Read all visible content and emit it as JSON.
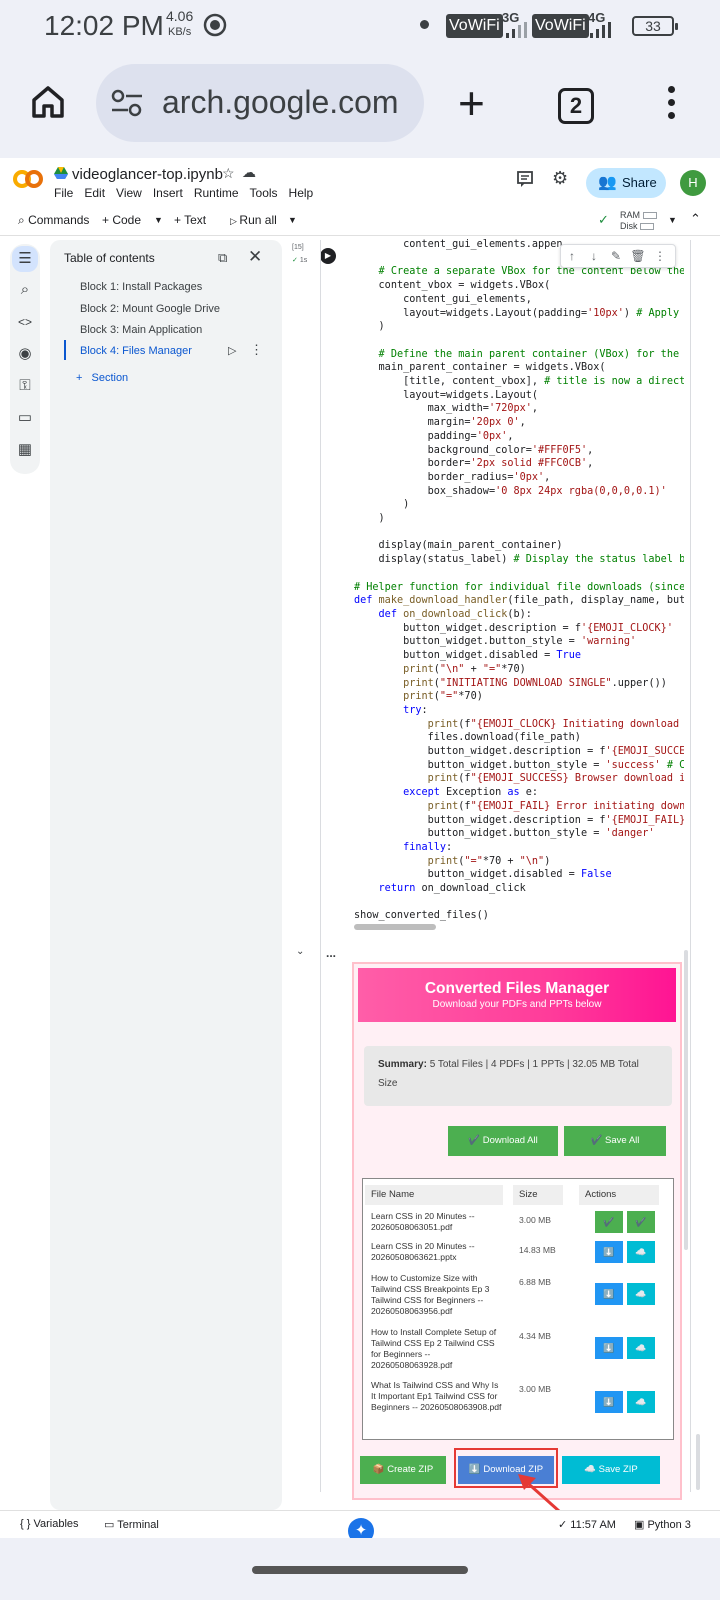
{
  "status_bar": {
    "time": "12:02 PM",
    "speed_value": "4.06",
    "speed_unit": "KB/s",
    "vowifi_1": "VoWiFi",
    "net_1": "3G",
    "vowifi_2": "VoWiFi",
    "net_2": "4G",
    "battery": "33"
  },
  "browser": {
    "url": "arch.google.com",
    "tab_count": "2"
  },
  "colab": {
    "notebook_title": "videoglancer-top.ipynb",
    "menu": [
      "File",
      "Edit",
      "View",
      "Insert",
      "Runtime",
      "Tools",
      "Help"
    ],
    "share_label": "Share",
    "avatar_letter": "H",
    "toolbar": {
      "commands": "Commands",
      "code": "+ Code",
      "text": "+ Text",
      "run_all": "Run all",
      "ram_label": "RAM",
      "disk_label": "Disk"
    }
  },
  "toc": {
    "title": "Table of contents",
    "items": [
      "Block 1: Install Packages",
      "Block 2: Mount Google Drive",
      "Block 3: Main Application",
      "Block 4: Files Manager"
    ],
    "add_section": "Section"
  },
  "cell": {
    "exec_count": "[15]",
    "exec_time": "1s",
    "output_ellipsis": "..."
  },
  "code_lines": [
    {
      "i": 8,
      "parts": [
        [
          "",
          "content_gui_elements.appen"
        ]
      ]
    },
    {
      "i": 0,
      "parts": [
        [
          "",
          ""
        ]
      ]
    },
    {
      "i": 4,
      "parts": [
        [
          "com",
          "# Create a separate VBox for the content below the"
        ]
      ]
    },
    {
      "i": 4,
      "parts": [
        [
          "",
          "content_vbox = widgets.VBox("
        ]
      ]
    },
    {
      "i": 8,
      "parts": [
        [
          "",
          "content_gui_elements,"
        ]
      ]
    },
    {
      "i": 8,
      "parts": [
        [
          "",
          "layout=widgets.Layout(padding="
        ],
        [
          "str",
          "'10px'"
        ],
        [
          "",
          ") "
        ],
        [
          "com",
          "# Apply"
        ]
      ]
    },
    {
      "i": 4,
      "parts": [
        [
          "",
          ")"
        ]
      ]
    },
    {
      "i": 0,
      "parts": [
        [
          "",
          ""
        ]
      ]
    },
    {
      "i": 4,
      "parts": [
        [
          "com",
          "# Define the main parent container (VBox) for the"
        ]
      ]
    },
    {
      "i": 4,
      "parts": [
        [
          "",
          "main_parent_container = widgets.VBox("
        ]
      ]
    },
    {
      "i": 8,
      "parts": [
        [
          "",
          "[title, content_vbox], "
        ],
        [
          "com",
          "# title is now a direct"
        ]
      ]
    },
    {
      "i": 8,
      "parts": [
        [
          "",
          "layout=widgets.Layout("
        ]
      ]
    },
    {
      "i": 12,
      "parts": [
        [
          "",
          "max_width="
        ],
        [
          "str",
          "'720px'"
        ],
        [
          "",
          ","
        ]
      ]
    },
    {
      "i": 12,
      "parts": [
        [
          "",
          "margin="
        ],
        [
          "str",
          "'20px 0'"
        ],
        [
          "",
          ","
        ]
      ]
    },
    {
      "i": 12,
      "parts": [
        [
          "",
          "padding="
        ],
        [
          "str",
          "'0px'"
        ],
        [
          "",
          ","
        ]
      ]
    },
    {
      "i": 12,
      "parts": [
        [
          "",
          "background_color="
        ],
        [
          "str",
          "'#FFF0F5'"
        ],
        [
          "",
          ","
        ]
      ]
    },
    {
      "i": 12,
      "parts": [
        [
          "",
          "border="
        ],
        [
          "str",
          "'2px solid #FFC0CB'"
        ],
        [
          "",
          ","
        ]
      ]
    },
    {
      "i": 12,
      "parts": [
        [
          "",
          "border_radius="
        ],
        [
          "str",
          "'0px'"
        ],
        [
          "",
          ","
        ]
      ]
    },
    {
      "i": 12,
      "parts": [
        [
          "",
          "box_shadow="
        ],
        [
          "str",
          "'0 8px 24px rgba(0,0,0,0.1)'"
        ]
      ]
    },
    {
      "i": 8,
      "parts": [
        [
          "",
          ")"
        ]
      ]
    },
    {
      "i": 4,
      "parts": [
        [
          "",
          ")"
        ]
      ]
    },
    {
      "i": 0,
      "parts": [
        [
          "",
          ""
        ]
      ]
    },
    {
      "i": 4,
      "parts": [
        [
          "",
          "display(main_parent_container)"
        ]
      ]
    },
    {
      "i": 4,
      "parts": [
        [
          "",
          "display(status_label) "
        ],
        [
          "com",
          "# Display the status label b"
        ]
      ]
    },
    {
      "i": 0,
      "parts": [
        [
          "",
          ""
        ]
      ]
    },
    {
      "i": 0,
      "parts": [
        [
          "com",
          "# Helper function for individual file downloads (since"
        ]
      ]
    },
    {
      "i": 0,
      "parts": [
        [
          "kw",
          "def "
        ],
        [
          "fn",
          "make_download_handler"
        ],
        [
          "",
          "(file_path, display_name, but"
        ]
      ]
    },
    {
      "i": 4,
      "parts": [
        [
          "kw",
          "def "
        ],
        [
          "fn",
          "on_download_click"
        ],
        [
          "",
          "(b):"
        ]
      ]
    },
    {
      "i": 8,
      "parts": [
        [
          "",
          "button_widget.description = f"
        ],
        [
          "str",
          "'{EMOJI_CLOCK}'"
        ]
      ]
    },
    {
      "i": 8,
      "parts": [
        [
          "",
          "button_widget.button_style = "
        ],
        [
          "str",
          "'warning'"
        ]
      ]
    },
    {
      "i": 8,
      "parts": [
        [
          "",
          "button_widget.disabled = "
        ],
        [
          "kw",
          "True"
        ]
      ]
    },
    {
      "i": 8,
      "parts": [
        [
          "fn",
          "print"
        ],
        [
          "",
          "("
        ],
        [
          "str",
          "\"\\n\""
        ],
        [
          "",
          " + "
        ],
        [
          "str",
          "\"=\""
        ],
        [
          "",
          "*70)"
        ]
      ]
    },
    {
      "i": 8,
      "parts": [
        [
          "fn",
          "print"
        ],
        [
          "",
          "("
        ],
        [
          "str",
          "\"INITIATING DOWNLOAD SINGLE\""
        ],
        [
          "",
          ".upper())"
        ]
      ]
    },
    {
      "i": 8,
      "parts": [
        [
          "fn",
          "print"
        ],
        [
          "",
          "("
        ],
        [
          "str",
          "\"=\""
        ],
        [
          "",
          "*70)"
        ]
      ]
    },
    {
      "i": 8,
      "parts": [
        [
          "kw",
          "try"
        ],
        [
          "",
          ":"
        ]
      ]
    },
    {
      "i": 12,
      "parts": [
        [
          "fn",
          "print"
        ],
        [
          "",
          "(f"
        ],
        [
          "str",
          "\"{EMOJI_CLOCK} Initiating download"
        ]
      ]
    },
    {
      "i": 12,
      "parts": [
        [
          "",
          "files.download(file_path)"
        ]
      ]
    },
    {
      "i": 12,
      "parts": [
        [
          "",
          "button_widget.description = f"
        ],
        [
          "str",
          "'{EMOJI_SUCCE"
        ]
      ]
    },
    {
      "i": 12,
      "parts": [
        [
          "",
          "button_widget.button_style = "
        ],
        [
          "str",
          "'success'"
        ],
        [
          "",
          " "
        ],
        [
          "com",
          "# C"
        ]
      ]
    },
    {
      "i": 12,
      "parts": [
        [
          "fn",
          "print"
        ],
        [
          "",
          "(f"
        ],
        [
          "str",
          "\"{EMOJI_SUCCESS} Browser download i"
        ]
      ]
    },
    {
      "i": 8,
      "parts": [
        [
          "kw",
          "except "
        ],
        [
          "",
          "Exception "
        ],
        [
          "kw",
          "as "
        ],
        [
          "",
          "e:"
        ]
      ]
    },
    {
      "i": 12,
      "parts": [
        [
          "fn",
          "print"
        ],
        [
          "",
          "(f"
        ],
        [
          "str",
          "\"{EMOJI_FAIL} Error initiating down"
        ]
      ]
    },
    {
      "i": 12,
      "parts": [
        [
          "",
          "button_widget.description = f"
        ],
        [
          "str",
          "'{EMOJI_FAIL}"
        ]
      ]
    },
    {
      "i": 12,
      "parts": [
        [
          "",
          "button_widget.button_style = "
        ],
        [
          "str",
          "'danger'"
        ]
      ]
    },
    {
      "i": 8,
      "parts": [
        [
          "kw",
          "finally"
        ],
        [
          "",
          ":"
        ]
      ]
    },
    {
      "i": 12,
      "parts": [
        [
          "fn",
          "print"
        ],
        [
          "",
          "("
        ],
        [
          "str",
          "\"=\""
        ],
        [
          "",
          "*70 + "
        ],
        [
          "str",
          "\"\\n\""
        ],
        [
          "",
          ")"
        ]
      ]
    },
    {
      "i": 12,
      "parts": [
        [
          "",
          "button_widget.disabled = "
        ],
        [
          "kw",
          "False"
        ]
      ]
    },
    {
      "i": 4,
      "parts": [
        [
          "kw",
          "return "
        ],
        [
          "",
          "on_download_click"
        ]
      ]
    },
    {
      "i": 0,
      "parts": [
        [
          "",
          ""
        ]
      ]
    },
    {
      "i": 0,
      "parts": [
        [
          "",
          "show_converted_files()"
        ]
      ]
    }
  ],
  "output": {
    "title": "Converted Files Manager",
    "subtitle": "Download your PDFs and PPTs below",
    "summary_label": "Summary:",
    "summary_text": "5 Total Files | 4 PDFs | 1 PPTs | 32.05 MB Total Size",
    "download_all": "✔️ Download All",
    "save_all": "✔️ Save All",
    "table_headers": [
      "File Name",
      "Size",
      "Actions"
    ],
    "rows": [
      {
        "name": "Learn CSS in 20 Minutes -- 20260508063051.pdf",
        "size": "3.00 MB",
        "a1": "✔️",
        "a2": "✔️"
      },
      {
        "name": "Learn CSS in 20 Minutes -- 20260508063621.pptx",
        "size": "14.83 MB",
        "a1": "⬇️",
        "a2": "☁️"
      },
      {
        "name": "How to Customize Size with Tailwind CSS Breakpoints Ep 3 Tailwind CSS for Beginners -- 20260508063956.pdf",
        "size": "6.88 MB",
        "a1": "⬇️",
        "a2": "☁️"
      },
      {
        "name": "How to Install Complete Setup of Tailwind CSS Ep 2 Tailwind CSS for Beginners -- 20260508063928.pdf",
        "size": "4.34 MB",
        "a1": "⬇️",
        "a2": "☁️"
      },
      {
        "name": "What Is Tailwind CSS and Why Is It Important Ep1 Tailwind CSS for Beginners -- 20260508063908.pdf",
        "size": "3.00 MB",
        "a1": "⬇️",
        "a2": "☁️"
      }
    ],
    "create_zip": "📦 Create ZIP",
    "download_zip": "⬇️ Download ZIP",
    "save_zip": "☁️ Save ZIP"
  },
  "bottom": {
    "variables": "Variables",
    "terminal": "Terminal",
    "time": "11:57 AM",
    "runtime": "Python 3"
  }
}
